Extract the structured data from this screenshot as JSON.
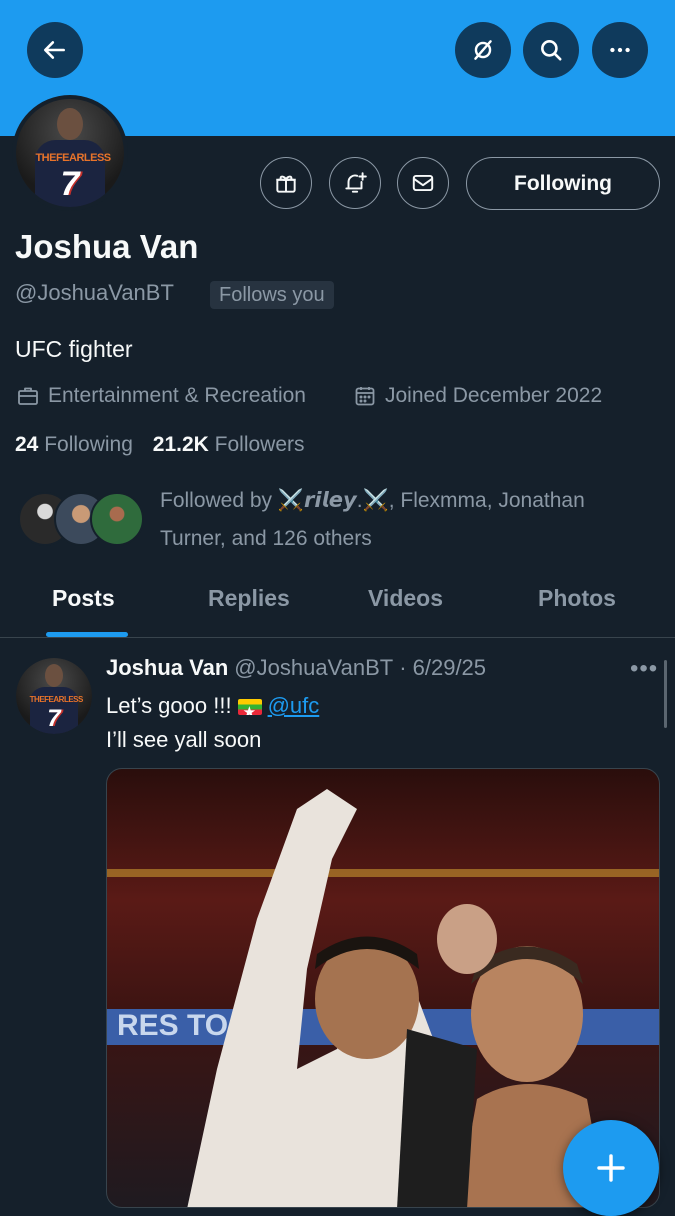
{
  "profile": {
    "name": "Joshua Van",
    "handle": "@JoshuaVanBT",
    "follows_you": "Follows you",
    "bio": "UFC fighter",
    "category": "Entertainment & Recreation",
    "joined": "Joined December 2022",
    "following_count": "24",
    "following_label": "Following",
    "followers_count": "21.2K",
    "followers_label": "Followers",
    "followed_by": "Followed by ⚔️𝙧𝙞𝙡𝙚𝙮.⚔️, Flexmma, Jonathan Turner, and 126 others",
    "avatar_jersey_text": "THEFEARLESS",
    "avatar_jersey_number": "7"
  },
  "actions": {
    "following_button": "Following"
  },
  "tabs": [
    {
      "label": "Posts",
      "active": true
    },
    {
      "label": "Replies",
      "active": false
    },
    {
      "label": "Videos",
      "active": false
    },
    {
      "label": "Photos",
      "active": false
    }
  ],
  "post": {
    "author": "Joshua Van",
    "handle": "@JoshuaVanBT",
    "date": "· 6/29/25",
    "more": "•••",
    "line1_text": "Let’s gooo !!!",
    "mention": "@ufc",
    "line2": "I’ll see yall soon"
  },
  "colors": {
    "accent": "#1d9bf0",
    "background": "#15202b",
    "secondary_text": "#8b98a5"
  },
  "icons": [
    "back-arrow-icon",
    "grok-icon",
    "search-icon",
    "more-icon",
    "gift-icon",
    "notification-add-icon",
    "mail-icon",
    "briefcase-icon",
    "calendar-icon",
    "compose-plus-icon"
  ]
}
